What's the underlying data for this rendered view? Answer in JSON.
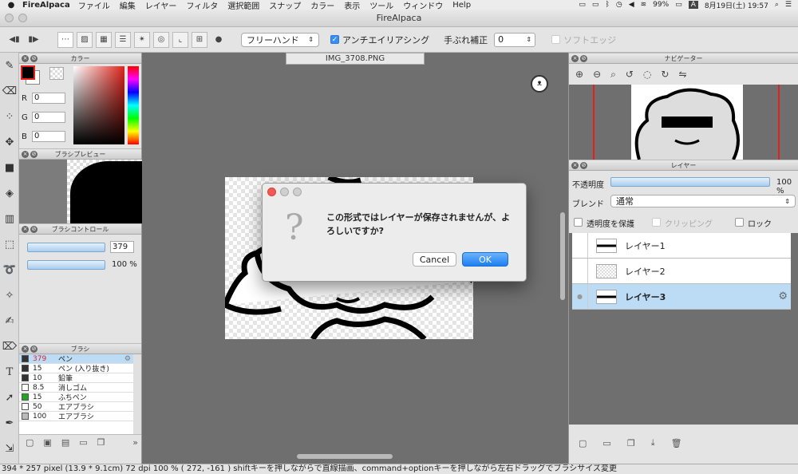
{
  "menubar": {
    "app_name": "FireAlpaca",
    "items": [
      "ファイル",
      "編集",
      "レイヤー",
      "フィルタ",
      "選択範囲",
      "スナップ",
      "カラー",
      "表示",
      "ツール",
      "ウィンドウ",
      "Help"
    ],
    "battery": "99%",
    "input_indicator": "A",
    "datetime": "8月19日(土)  19:57"
  },
  "window": {
    "title": "FireAlpaca"
  },
  "toolbar": {
    "brush_mode": "フリーハンド",
    "antialias_label": "アンチエイリアシング",
    "stabilizer_label": "手ぶれ補正",
    "stabilizer_value": "0",
    "soft_edge_label": "ソフトエッジ"
  },
  "color_panel": {
    "title": "カラー",
    "r_label": "R",
    "g_label": "G",
    "b_label": "B",
    "r": "0",
    "g": "0",
    "b": "0",
    "fg": "#000000",
    "bg": "#ffffff",
    "accent": "#e3201b"
  },
  "brush_preview": {
    "title": "ブラシプレビュー"
  },
  "brush_control": {
    "title": "ブラシコントロール",
    "size": "379",
    "opacity": "100 %"
  },
  "brush_list": {
    "title": "ブラシ",
    "items": [
      {
        "size": "379",
        "name": "ペン",
        "color": "#333333"
      },
      {
        "size": "15",
        "name": "ペン (入り抜き)",
        "color": "#333333"
      },
      {
        "size": "10",
        "name": "鉛筆",
        "color": "#333333"
      },
      {
        "size": "8.5",
        "name": "消しゴム",
        "color": "#ffffff"
      },
      {
        "size": "15",
        "name": "ふちペン",
        "color": "#21a621"
      },
      {
        "size": "50",
        "name": "エアブラシ",
        "color": "#ffffff"
      },
      {
        "size": "100",
        "name": "エアブラシ",
        "color": "#bbbbbb"
      }
    ]
  },
  "document": {
    "tab_title": "IMG_3708.PNG"
  },
  "dialog": {
    "message": "この形式ではレイヤーが保存されませんが、よろしいですか?",
    "icon_glyph": "?",
    "cancel_label": "Cancel",
    "ok_label": "OK"
  },
  "navigator": {
    "title": "ナビゲーター"
  },
  "layers_panel": {
    "title": "レイヤー",
    "opacity_label": "不透明度",
    "opacity_value": "100 %",
    "blend_label": "ブレンド",
    "blend_value": "通常",
    "protect_alpha_label": "透明度を保護",
    "clipping_label": "クリッピング",
    "lock_label": "ロック",
    "layers": [
      {
        "name": "レイヤー1"
      },
      {
        "name": "レイヤー2"
      },
      {
        "name": "レイヤー3"
      }
    ]
  },
  "status": {
    "text": "394 * 257 pixel   (13.9 * 9.1cm)   72 dpi   100 %   ( 272, -161 )   shiftキーを押しながらで直線描画、command+optionキーを押しながら左右ドラッグでブラシサイズ変更"
  }
}
